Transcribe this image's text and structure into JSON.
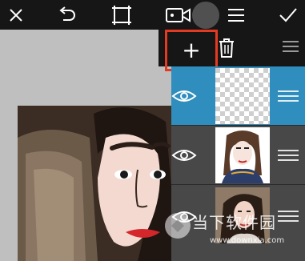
{
  "toolbar": {
    "buttons": [
      {
        "name": "close-button",
        "icon": "close-icon"
      },
      {
        "name": "undo-button",
        "icon": "undo-icon"
      },
      {
        "name": "crop-button",
        "icon": "crop-icon"
      },
      {
        "name": "video-button",
        "icon": "video-camera-icon"
      },
      {
        "name": "menu-button",
        "icon": "menu-icon"
      },
      {
        "name": "confirm-button",
        "icon": "checkmark-icon"
      }
    ]
  },
  "layers": {
    "add_label": "+",
    "highlight_color": "#e53a22",
    "selected_color": "#2f8ebd",
    "rows": [
      {
        "name": "layer-transparent",
        "selected": true
      },
      {
        "name": "layer-illustration",
        "selected": false
      },
      {
        "name": "layer-photo",
        "selected": false
      }
    ]
  },
  "watermark": {
    "text": "当下软件园",
    "url": "www.downxia.com"
  }
}
